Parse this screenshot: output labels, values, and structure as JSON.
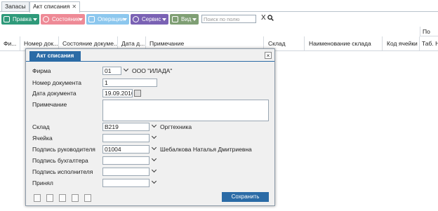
{
  "tabs": [
    "Запасы",
    "Акт списания"
  ],
  "toolbar": {
    "pravka": "Правка",
    "sostoyanie": "Состояние",
    "operatsii": "Операции",
    "servis": "Сервис",
    "vid": "Вид",
    "search_placeholder": "Поиск по полю",
    "clear": "X"
  },
  "grid": {
    "group_header": "По",
    "columns": [
      "Фи...",
      "Номер док...",
      "Состояние докуме...",
      "Дата д...",
      "Примечание",
      "Склад",
      "Наименование склада",
      "Код ячейки",
      "Таб. Н"
    ]
  },
  "dialog": {
    "title": "Акт списания",
    "close": "×",
    "labels": {
      "firma": "Фирма",
      "nomer": "Номер документа",
      "data": "Дата документа",
      "primechanie": "Примечание",
      "sklad": "Склад",
      "yacheyka": "Ячейка",
      "ruk": "Подпись руководителя",
      "buh": "Подпись бухгалтера",
      "isp": "Подпись исполнителя",
      "prinyal": "Принял"
    },
    "values": {
      "firma_code": "01",
      "firma_name": "ООО \"ИЛАДА\"",
      "nomer": "1",
      "data": "19.09.2016",
      "primechanie": "",
      "sklad_code": "B219",
      "sklad_name": "Оргтехника",
      "yacheyka": "",
      "ruk_code": "01004",
      "ruk_name": "Шебалкова Наталья Дмитриевна",
      "buh": "",
      "isp": "",
      "prinyal": ""
    },
    "save_label": "Сохранить"
  },
  "colors": {
    "accent": "#2b6ba6",
    "pravka": "#2f9a7a",
    "sostoyanie": "#ee8a96",
    "operatsii": "#8cc7ee",
    "servis": "#7a62b4",
    "vid": "#7f9f74"
  }
}
